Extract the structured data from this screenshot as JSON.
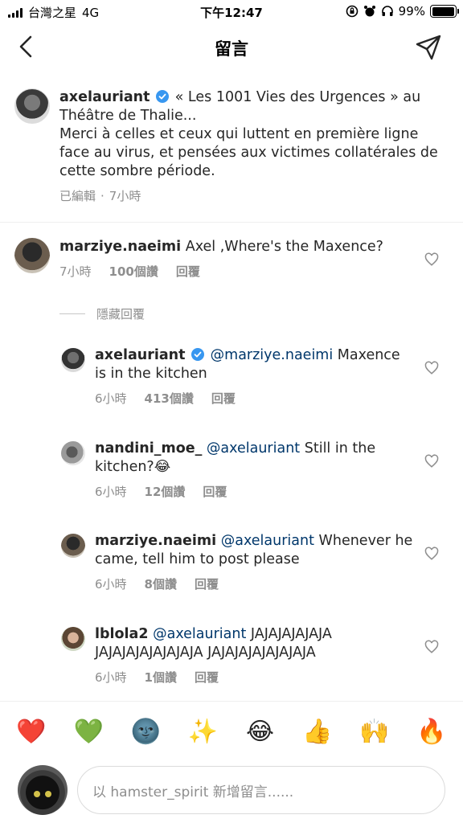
{
  "status_bar": {
    "carrier": "台灣之星",
    "network": "4G",
    "time": "下午12:47",
    "battery": "99%",
    "battery_level": 0.99
  },
  "header": {
    "title": "留言"
  },
  "caption": {
    "username": "axelauriant",
    "text_line1": "« Les 1001 Vies des Urgences » au Théâtre de Thalie...",
    "text_line2": "Merci à celles et ceux qui luttent en première ligne face au virus, et pensées aux victimes collatérales de cette sombre période.",
    "edited": "已編輯",
    "separator": "·",
    "time": "7小時"
  },
  "comments": [
    {
      "username": "marziye.naeimi",
      "text": "Axel ,Where's the Maxence?",
      "time": "7小時",
      "likes": "100個讚",
      "reply": "回覆"
    }
  ],
  "hide_replies_label": "隱藏回覆",
  "replies": [
    {
      "username": "axelauriant",
      "mention": "@marziye.naeimi",
      "text": "Maxence is in the kitchen",
      "time": "6小時",
      "likes": "413個讚",
      "reply": "回覆"
    },
    {
      "username": "nandini_moe_",
      "mention": "@axelauriant",
      "text": "Still in the kitchen?😂",
      "time": "6小時",
      "likes": "12個讚",
      "reply": "回覆"
    },
    {
      "username": "marziye.naeimi",
      "mention": "@axelauriant",
      "text": "Whenever he came, tell him to post please",
      "time": "6小時",
      "likes": "8個讚",
      "reply": "回覆"
    },
    {
      "username": "lblola2",
      "mention": "@axelauriant",
      "text": "JAJAJAJAJAJA JAJAJAJAJAJAJAJA JAJAJAJAJAJAJAJA",
      "time": "6小時",
      "likes": "1個讚",
      "reply": "回覆"
    }
  ],
  "emoji_bar": [
    "❤️",
    "💚",
    "🌚",
    "✨",
    "😂",
    "👍",
    "🙌",
    "🔥"
  ],
  "composer": {
    "placeholder": "以 hamster_spirit 新增留言......"
  },
  "colors": {
    "mention": "#00376b",
    "secondary_text": "#8e8e8e",
    "verified": "#3897f0"
  }
}
